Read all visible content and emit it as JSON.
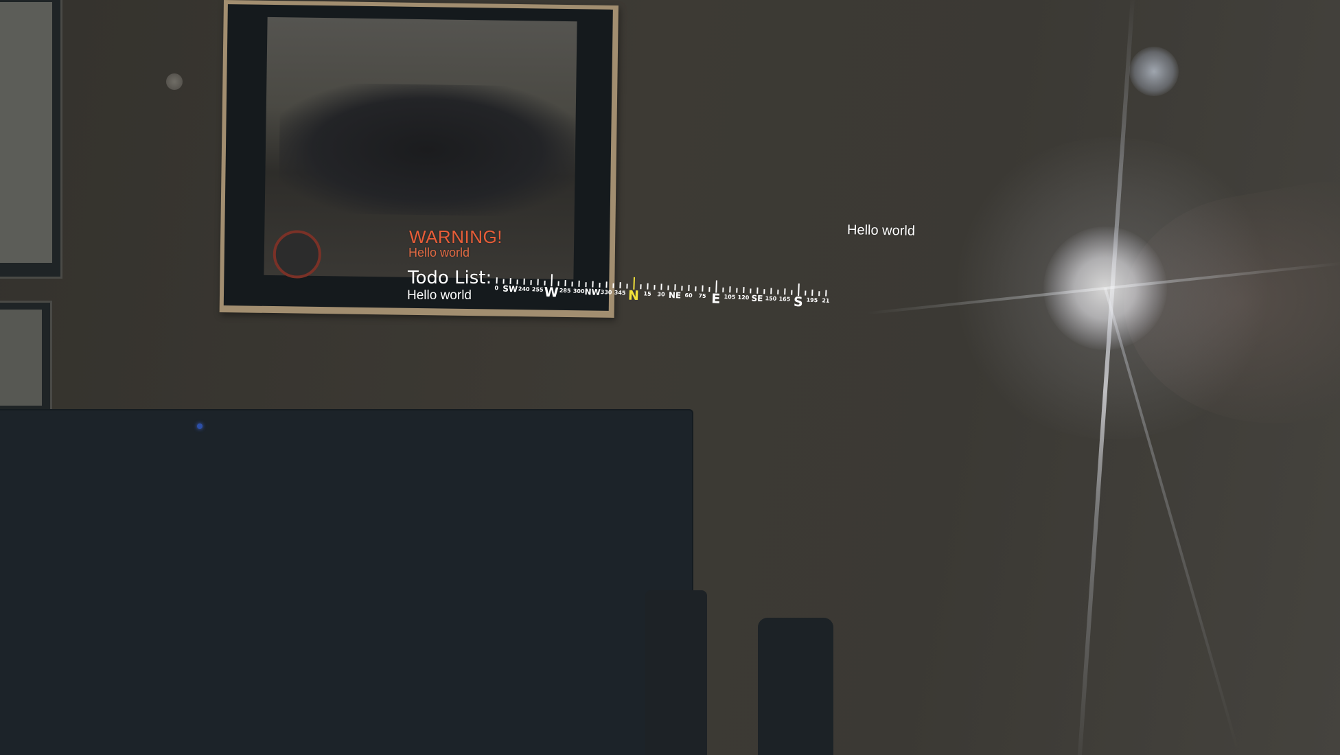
{
  "hud": {
    "warning": {
      "title": "WARNING!",
      "message": "Hello world",
      "color": "#e85d38"
    },
    "todo": {
      "title": "Todo List:",
      "items": [
        "Hello world"
      ]
    },
    "floating_label": "Hello world"
  },
  "compass": {
    "labels": [
      "0",
      "SW",
      "240",
      "255",
      "W",
      "285",
      "300",
      "NW",
      "330",
      "345",
      "N",
      "15",
      "30",
      "NE",
      "60",
      "75",
      "E",
      "105",
      "120",
      "SE",
      "150",
      "165",
      "S",
      "195",
      "21"
    ],
    "heading_label": "N",
    "heading_color": "#f2e23a",
    "label_color": "#ffffff"
  },
  "scene": {
    "description_free": true
  }
}
